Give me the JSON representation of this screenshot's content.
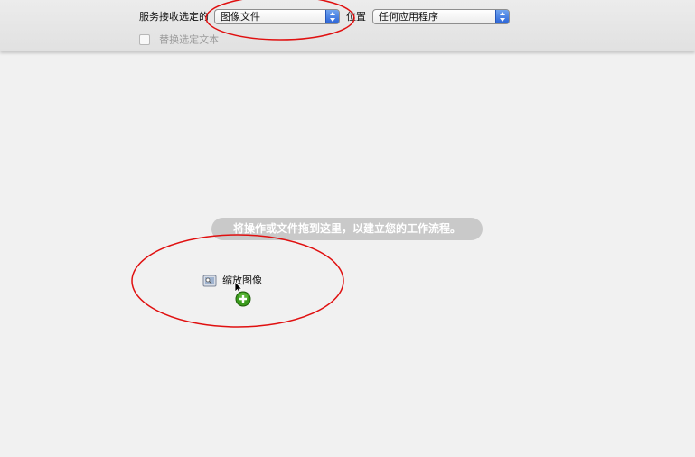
{
  "header": {
    "service_receives_label": "服务接收选定的",
    "input_type_value": "图像文件",
    "in_label": "位置",
    "application_value": "任何应用程序",
    "replace_selected_text_label": "替换选定文本",
    "replace_selected_text_checked": false
  },
  "workflow": {
    "drop_hint": "将操作或文件拖到这里，以建立您的工作流程。",
    "dragged_action": {
      "label": "缩放图像",
      "icon": "preview-app-icon"
    },
    "cursor_icon": "arrow-cursor-icon",
    "badge_icon": "add-plus-badge-icon"
  },
  "colors": {
    "background": "#f1f1f1",
    "toolbar": "#e6e6e6",
    "popup_arrow": "#3f79e3",
    "hint_pill": "#c9c9c9",
    "add_badge": "#3a9a1c",
    "annotation": "#e01010"
  }
}
